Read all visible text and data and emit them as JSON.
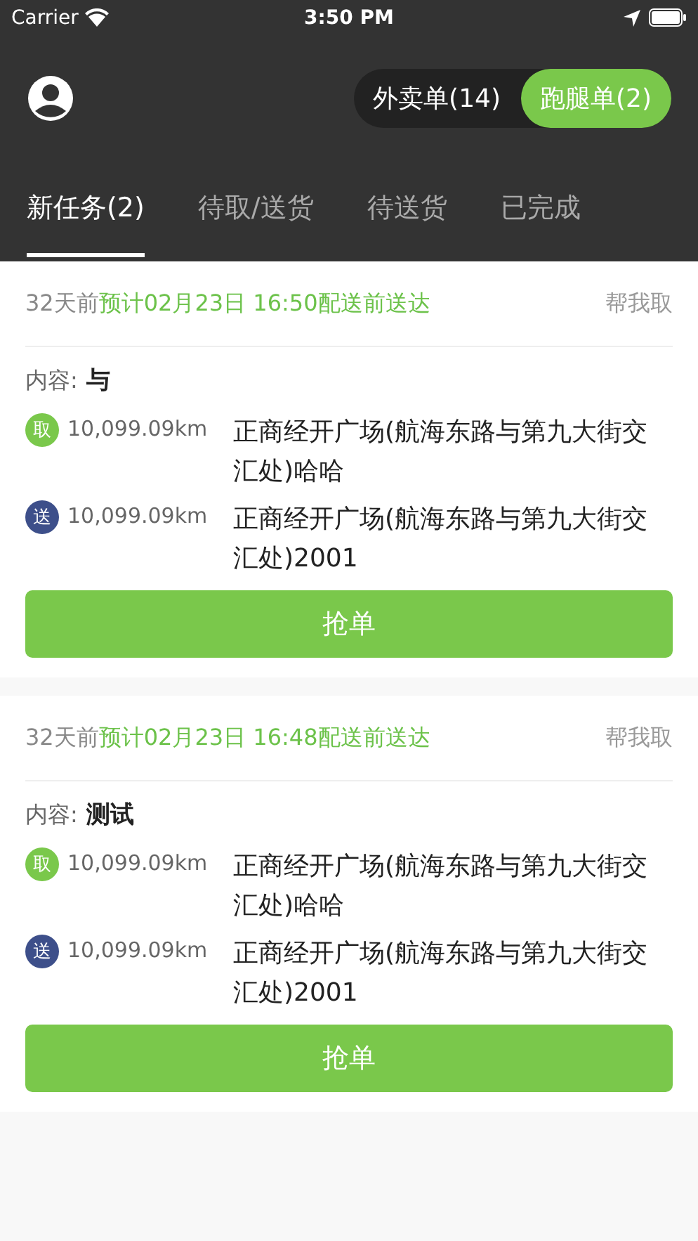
{
  "status_bar": {
    "carrier": "Carrier",
    "time": "3:50 PM"
  },
  "segments": [
    {
      "label": "外卖单(14)",
      "selected": false
    },
    {
      "label": "跑腿单(2)",
      "selected": true
    }
  ],
  "tabs": [
    {
      "label": "新任务(2)",
      "selected": true
    },
    {
      "label": "待取/送货",
      "selected": false
    },
    {
      "label": "待送货",
      "selected": false
    },
    {
      "label": "已完成",
      "selected": false
    }
  ],
  "orders": [
    {
      "age": "32天前",
      "eta": "预计02月23日 16:50配送前送达",
      "type": "帮我取",
      "content_label": "内容:",
      "content": "与",
      "stops": [
        {
          "kind": "pickup",
          "badge": "取",
          "distance": "10,099.09km",
          "address": "正商经开广场(航海东路与第九大街交汇处)哈哈"
        },
        {
          "kind": "deliver",
          "badge": "送",
          "distance": "10,099.09km",
          "address": "正商经开广场(航海东路与第九大街交汇处)2001"
        }
      ],
      "button": "抢单"
    },
    {
      "age": "32天前",
      "eta": "预计02月23日 16:48配送前送达",
      "type": "帮我取",
      "content_label": "内容:",
      "content": "测试",
      "stops": [
        {
          "kind": "pickup",
          "badge": "取",
          "distance": "10,099.09km",
          "address": "正商经开广场(航海东路与第九大街交汇处)哈哈"
        },
        {
          "kind": "deliver",
          "badge": "送",
          "distance": "10,099.09km",
          "address": "正商经开广场(航海东路与第九大街交汇处)2001"
        }
      ],
      "button": "抢单"
    }
  ]
}
